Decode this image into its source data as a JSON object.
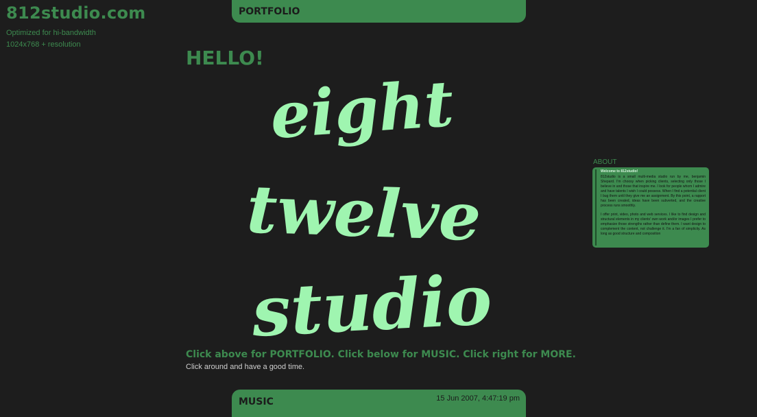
{
  "header": {
    "site_title": "812studio.com",
    "note_line1": "Optimized for hi-bandwidth",
    "note_line2": "1024x768  + resolution"
  },
  "nav": {
    "top_tab_label": "PORTFOLIO",
    "bottom_tab_label": "MUSIC",
    "clock": "15 Jun 2007,  4:47:19 pm"
  },
  "main": {
    "greeting": "HELLO!",
    "logo_words": [
      "eight",
      "twelve",
      "studio"
    ],
    "instruction": "Click above for PORTFOLIO.  Click below for MUSIC. Click right for MORE.",
    "subline": "Click around and have a good time."
  },
  "about": {
    "heading": "ABOUT",
    "title": "Welcome to 812studio!",
    "paragraph1": "812studio is a small multi-media studio run by me, benjamin Shepard. I'm choosy when picking clients, selecting only those I believe in and those that inspire me. I look for people whom I admire and have talents I wish I could possess. When I find a potential client I bug them until they give me an assignment. By this point, a rapport has been created, ideas have been subverted, and the creative process runs smoothly.",
    "paragraph2": "I offer print, video, photo and web services. I like to find design and structural elements in my clients' own work and/or images I prefer to emphasize those strengths rather than define them. I want design to complement the content, not challenge it. I'm a fan of simplicity. As long as good structure and composition"
  },
  "colors": {
    "background": "#1d1d1d",
    "accent_green": "#3d8a4f",
    "logo_mint": "#9ff5b0"
  }
}
